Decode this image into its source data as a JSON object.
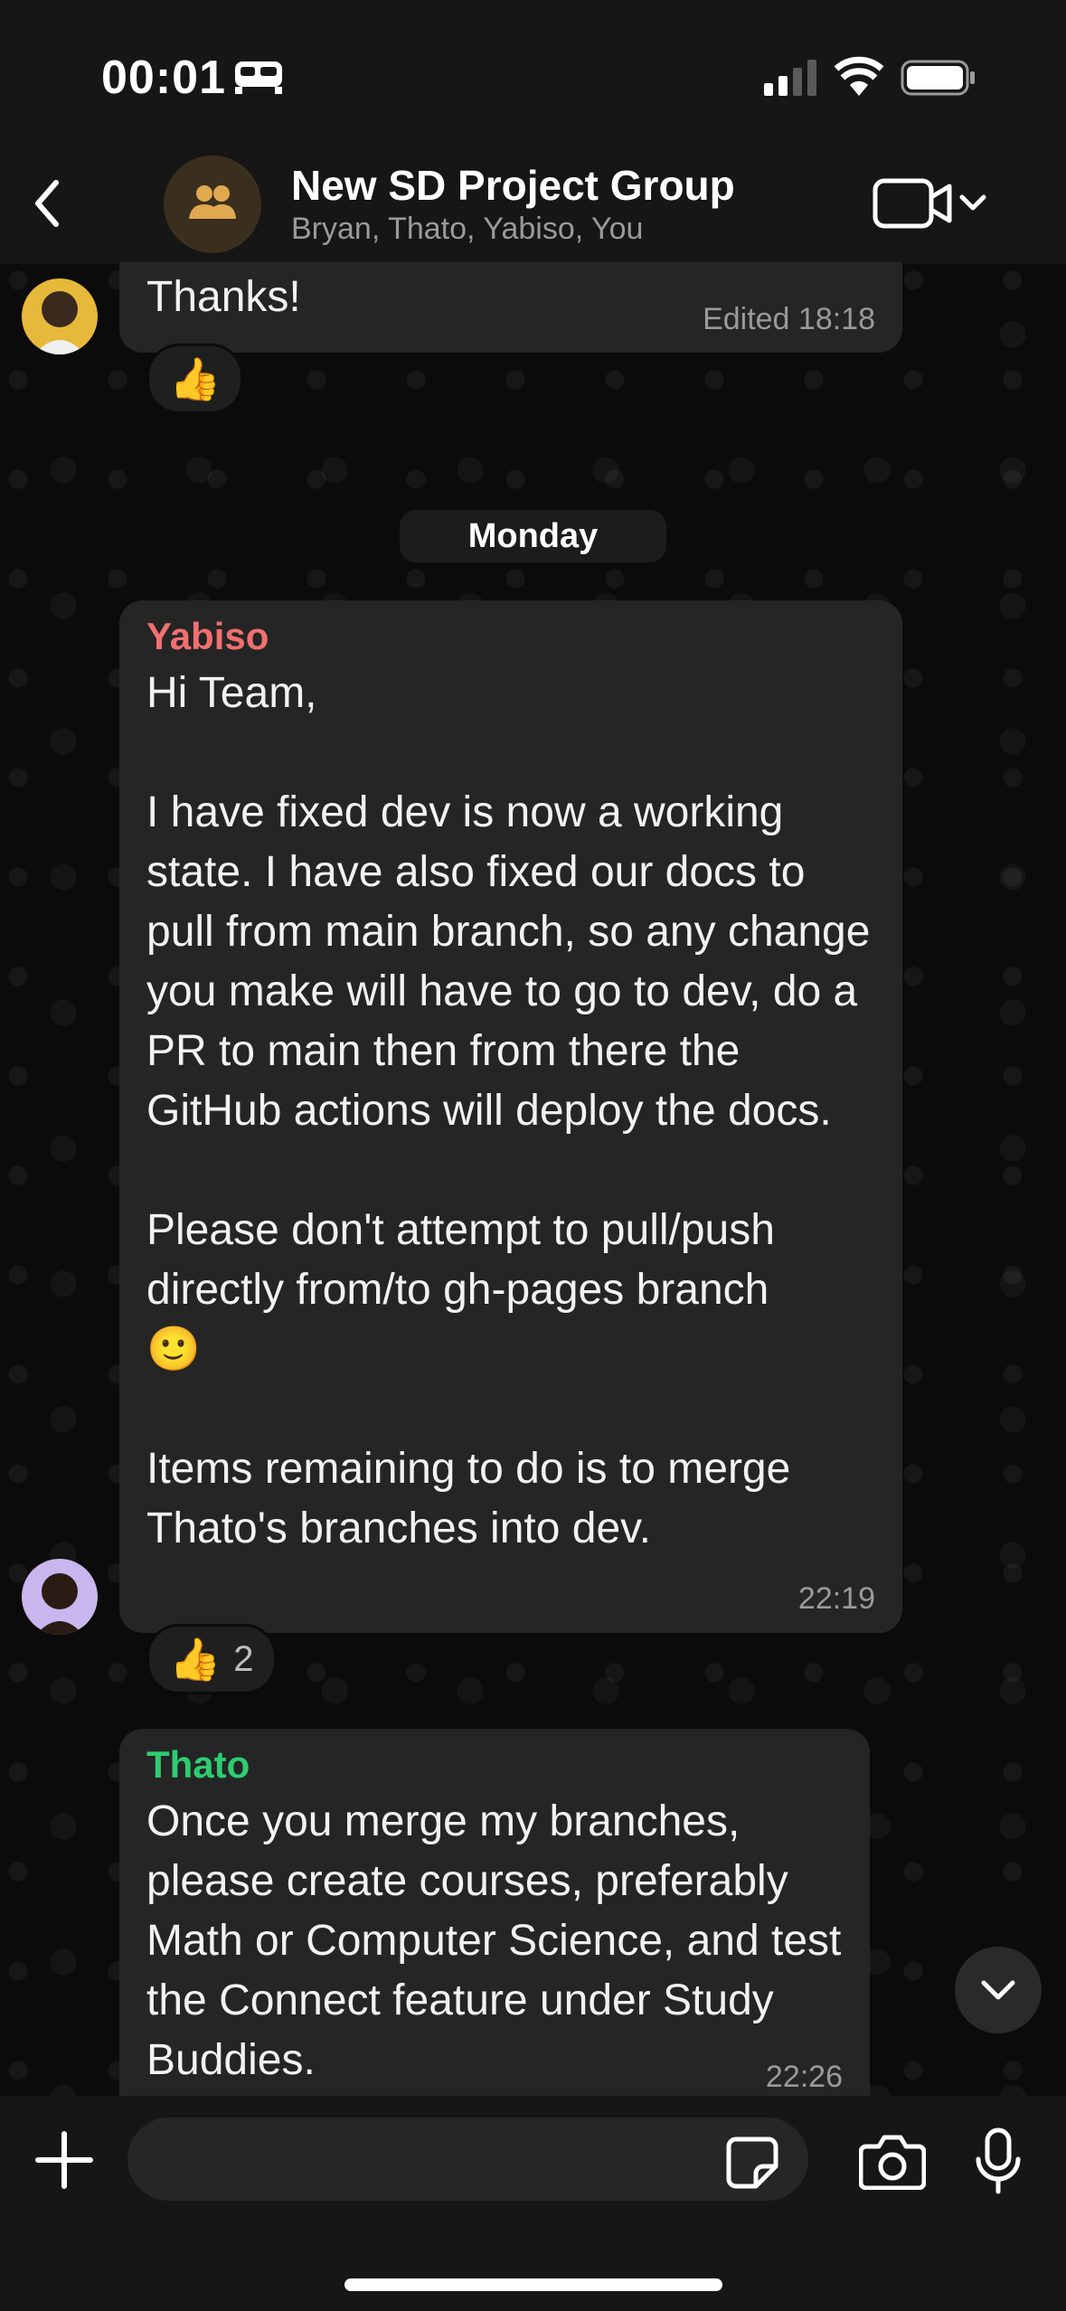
{
  "status_bar": {
    "time": "00:01"
  },
  "header": {
    "group_name": "New SD Project Group",
    "members": "Bryan, Thato, Yabiso, You"
  },
  "messages": [
    {
      "text": "Thanks!",
      "meta": "Edited 18:18",
      "reaction": {
        "emoji": "👍",
        "count": ""
      }
    },
    {
      "sender": "Yabiso",
      "sender_color": "#f07070",
      "text": "Hi Team,\n\nI have fixed dev is now a working state. I have also fixed our docs to pull from main branch, so any change you make will have to go to dev, do a PR to main then from there the GitHub actions will deploy the docs.\n\nPlease don't attempt to pull/push directly from/to gh-pages branch\n🙂\n\nItems remaining to do is to merge Thato's branches into dev.",
      "meta": "22:19",
      "reaction": {
        "emoji": "👍",
        "count": "2"
      }
    },
    {
      "sender": "Thato",
      "sender_color": "#2ecc71",
      "text": "Once you merge my branches, please create courses, preferably Math or Computer Science, and test the Connect feature under Study Buddies.",
      "meta": "22:26"
    }
  ],
  "day_divider": "Monday",
  "composer": {
    "placeholder": ""
  },
  "colors": {
    "bubble": "#252525",
    "background": "#0b0b0b",
    "bar": "#161616"
  }
}
